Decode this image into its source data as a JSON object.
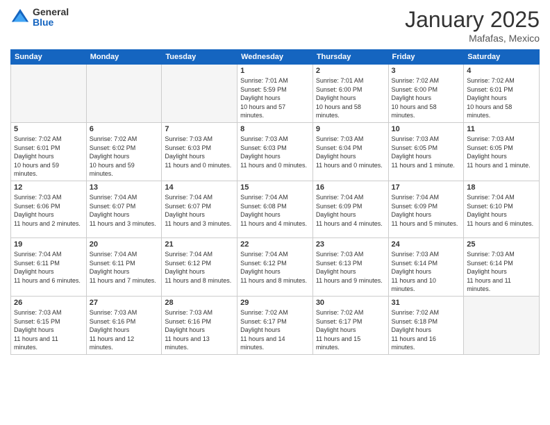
{
  "logo": {
    "general": "General",
    "blue": "Blue"
  },
  "title": "January 2025",
  "subtitle": "Mafafas, Mexico",
  "days_header": [
    "Sunday",
    "Monday",
    "Tuesday",
    "Wednesday",
    "Thursday",
    "Friday",
    "Saturday"
  ],
  "weeks": [
    [
      {
        "day": "",
        "empty": true
      },
      {
        "day": "",
        "empty": true
      },
      {
        "day": "",
        "empty": true
      },
      {
        "day": "1",
        "sunrise": "7:01 AM",
        "sunset": "5:59 PM",
        "daylight": "10 hours and 57 minutes."
      },
      {
        "day": "2",
        "sunrise": "7:01 AM",
        "sunset": "6:00 PM",
        "daylight": "10 hours and 58 minutes."
      },
      {
        "day": "3",
        "sunrise": "7:02 AM",
        "sunset": "6:00 PM",
        "daylight": "10 hours and 58 minutes."
      },
      {
        "day": "4",
        "sunrise": "7:02 AM",
        "sunset": "6:01 PM",
        "daylight": "10 hours and 58 minutes."
      }
    ],
    [
      {
        "day": "5",
        "sunrise": "7:02 AM",
        "sunset": "6:01 PM",
        "daylight": "10 hours and 59 minutes."
      },
      {
        "day": "6",
        "sunrise": "7:02 AM",
        "sunset": "6:02 PM",
        "daylight": "10 hours and 59 minutes."
      },
      {
        "day": "7",
        "sunrise": "7:03 AM",
        "sunset": "6:03 PM",
        "daylight": "11 hours and 0 minutes."
      },
      {
        "day": "8",
        "sunrise": "7:03 AM",
        "sunset": "6:03 PM",
        "daylight": "11 hours and 0 minutes."
      },
      {
        "day": "9",
        "sunrise": "7:03 AM",
        "sunset": "6:04 PM",
        "daylight": "11 hours and 0 minutes."
      },
      {
        "day": "10",
        "sunrise": "7:03 AM",
        "sunset": "6:05 PM",
        "daylight": "11 hours and 1 minute."
      },
      {
        "day": "11",
        "sunrise": "7:03 AM",
        "sunset": "6:05 PM",
        "daylight": "11 hours and 1 minute."
      }
    ],
    [
      {
        "day": "12",
        "sunrise": "7:03 AM",
        "sunset": "6:06 PM",
        "daylight": "11 hours and 2 minutes."
      },
      {
        "day": "13",
        "sunrise": "7:04 AM",
        "sunset": "6:07 PM",
        "daylight": "11 hours and 3 minutes."
      },
      {
        "day": "14",
        "sunrise": "7:04 AM",
        "sunset": "6:07 PM",
        "daylight": "11 hours and 3 minutes."
      },
      {
        "day": "15",
        "sunrise": "7:04 AM",
        "sunset": "6:08 PM",
        "daylight": "11 hours and 4 minutes."
      },
      {
        "day": "16",
        "sunrise": "7:04 AM",
        "sunset": "6:09 PM",
        "daylight": "11 hours and 4 minutes."
      },
      {
        "day": "17",
        "sunrise": "7:04 AM",
        "sunset": "6:09 PM",
        "daylight": "11 hours and 5 minutes."
      },
      {
        "day": "18",
        "sunrise": "7:04 AM",
        "sunset": "6:10 PM",
        "daylight": "11 hours and 6 minutes."
      }
    ],
    [
      {
        "day": "19",
        "sunrise": "7:04 AM",
        "sunset": "6:11 PM",
        "daylight": "11 hours and 6 minutes."
      },
      {
        "day": "20",
        "sunrise": "7:04 AM",
        "sunset": "6:11 PM",
        "daylight": "11 hours and 7 minutes."
      },
      {
        "day": "21",
        "sunrise": "7:04 AM",
        "sunset": "6:12 PM",
        "daylight": "11 hours and 8 minutes."
      },
      {
        "day": "22",
        "sunrise": "7:04 AM",
        "sunset": "6:12 PM",
        "daylight": "11 hours and 8 minutes."
      },
      {
        "day": "23",
        "sunrise": "7:03 AM",
        "sunset": "6:13 PM",
        "daylight": "11 hours and 9 minutes."
      },
      {
        "day": "24",
        "sunrise": "7:03 AM",
        "sunset": "6:14 PM",
        "daylight": "11 hours and 10 minutes."
      },
      {
        "day": "25",
        "sunrise": "7:03 AM",
        "sunset": "6:14 PM",
        "daylight": "11 hours and 11 minutes."
      }
    ],
    [
      {
        "day": "26",
        "sunrise": "7:03 AM",
        "sunset": "6:15 PM",
        "daylight": "11 hours and 11 minutes."
      },
      {
        "day": "27",
        "sunrise": "7:03 AM",
        "sunset": "6:16 PM",
        "daylight": "11 hours and 12 minutes."
      },
      {
        "day": "28",
        "sunrise": "7:03 AM",
        "sunset": "6:16 PM",
        "daylight": "11 hours and 13 minutes."
      },
      {
        "day": "29",
        "sunrise": "7:02 AM",
        "sunset": "6:17 PM",
        "daylight": "11 hours and 14 minutes."
      },
      {
        "day": "30",
        "sunrise": "7:02 AM",
        "sunset": "6:17 PM",
        "daylight": "11 hours and 15 minutes."
      },
      {
        "day": "31",
        "sunrise": "7:02 AM",
        "sunset": "6:18 PM",
        "daylight": "11 hours and 16 minutes."
      },
      {
        "day": "",
        "empty": true
      }
    ]
  ]
}
